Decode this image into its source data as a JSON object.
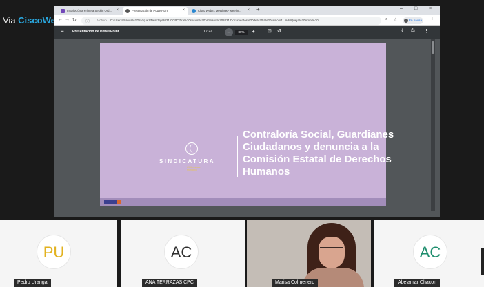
{
  "watermark": {
    "prefix": "Via ",
    "brand": "CiscoWebex"
  },
  "browser": {
    "tabs": [
      {
        "label": "Inscripción a Primera Sesión Ord...",
        "icon": "forms-icon",
        "color": "#7248b9"
      },
      {
        "label": "Presentación de PowerPoint",
        "icon": "chrome-pdf-icon",
        "color": "#555555"
      },
      {
        "label": "Cisco Webex Meetings - Meetin...",
        "icon": "webex-icon",
        "color": "#2a87d0"
      }
    ],
    "new_tab_symbol": "+",
    "window_controls": [
      "–",
      "□",
      "×"
    ],
    "address": {
      "scheme_label": "Archivo",
      "url": "C:/Users/Blanca%20Vázquez/Desktop/2021/CCPC/1ra%20sesión%20ordinaria%202021/Documentos%20de%20la%20sesión/11.%20Queja%20Amor%20..."
    },
    "incognito_label": "En pausa"
  },
  "pdf": {
    "title": "Presentación de PowerPoint",
    "page_indicator": "1 / 22",
    "zoom": "80%",
    "zoom_out_symbol": "–",
    "zoom_in_symbol": "+"
  },
  "slide": {
    "org_name": "SINDICATURA",
    "org_sub": "Chihuahua",
    "org_sub2": "Municipio",
    "title": "Contraloría Social, Guardianes Ciudadanos y denuncia a la Comisión Estatal de Derechos Humanos"
  },
  "participants": [
    {
      "initials": "PU",
      "name": "Pedro Uranga",
      "initials_color": "#e2b21f"
    },
    {
      "initials": "AC",
      "name": "ANA TERRAZAS CPC",
      "initials_color": "#2f2f2f"
    },
    {
      "initials": "",
      "name": "Marisa Colmenero",
      "video": true
    },
    {
      "initials": "AC",
      "name": "Abelamar Chacon",
      "initials_color": "#1f8e6e"
    }
  ]
}
